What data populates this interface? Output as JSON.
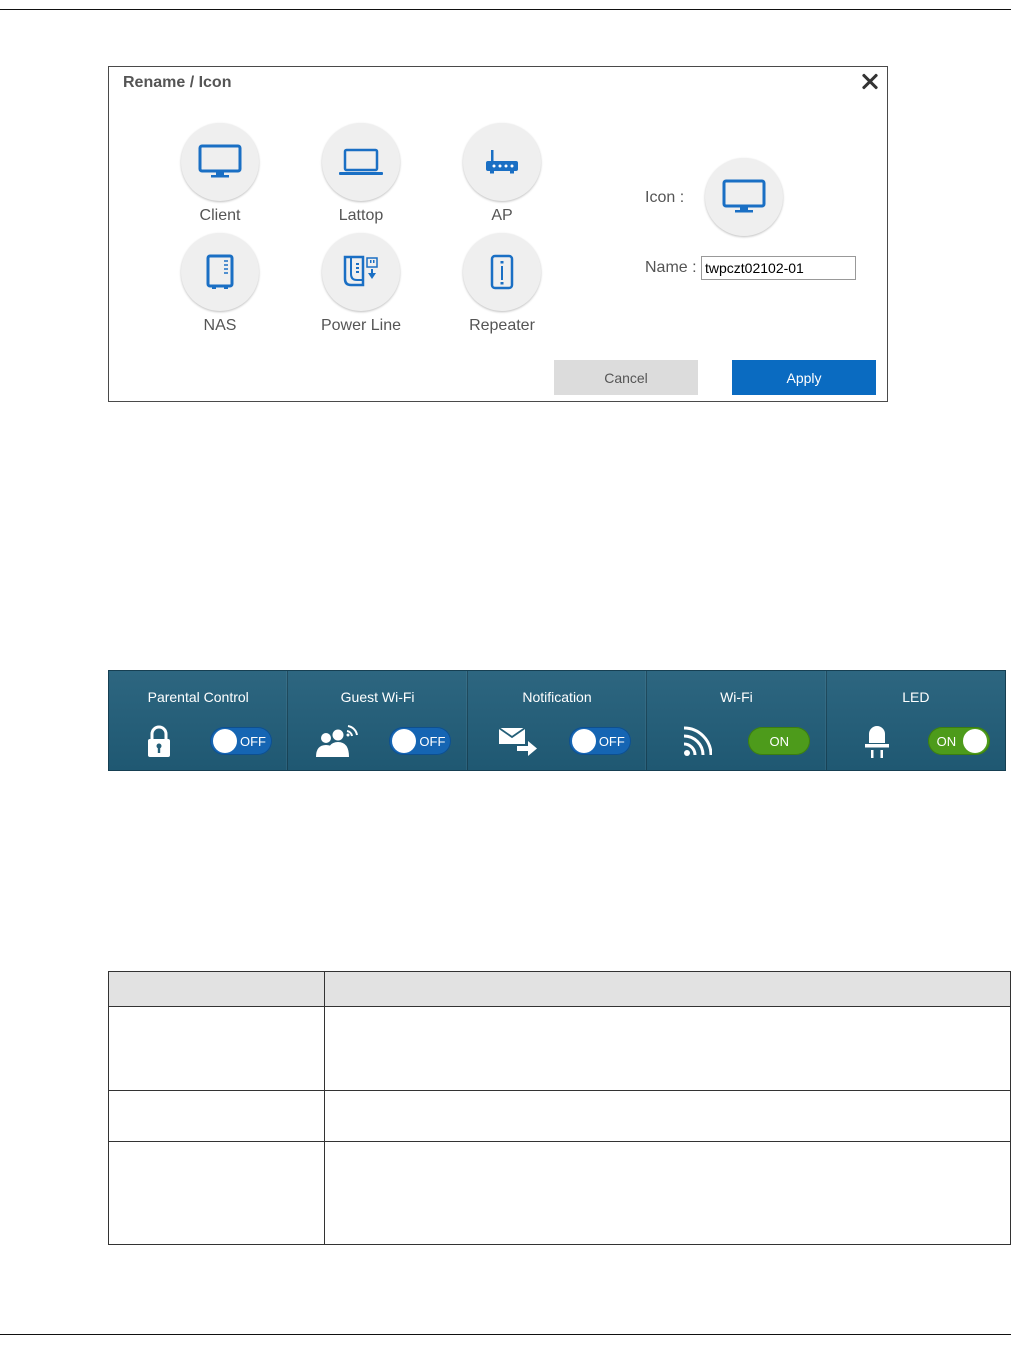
{
  "dialog": {
    "title": "Rename / Icon",
    "icon_options": [
      {
        "label": "Client",
        "icon": "monitor-icon"
      },
      {
        "label": "Lattop",
        "icon": "laptop-icon"
      },
      {
        "label": "AP",
        "icon": "router-icon"
      },
      {
        "label": "NAS",
        "icon": "nas-icon"
      },
      {
        "label": "Power Line",
        "icon": "power-line-icon"
      },
      {
        "label": "Repeater",
        "icon": "repeater-icon"
      }
    ],
    "icon_field_label": "Icon :",
    "selected_icon": "monitor-icon",
    "name_field_label": "Name :",
    "name_value": "twpczt02102-01",
    "cancel_label": "Cancel",
    "apply_label": "Apply"
  },
  "quick_settings": [
    {
      "title": "Parental Control",
      "icon": "lock-icon",
      "state": "OFF"
    },
    {
      "title": "Guest Wi-Fi",
      "icon": "guest-wifi-icon",
      "state": "OFF"
    },
    {
      "title": "Notification",
      "icon": "notification-icon",
      "state": "OFF"
    },
    {
      "title": "Wi-Fi",
      "icon": "wifi-icon",
      "state": "ON"
    },
    {
      "title": "LED",
      "icon": "led-icon",
      "state": "ON"
    }
  ],
  "colors": {
    "accent_blue": "#0a6bc1",
    "icon_blue": "#1a6fc4",
    "toggle_off": "#1565b3",
    "toggle_on": "#4d9b1b",
    "bar_background": "#2a6580"
  }
}
